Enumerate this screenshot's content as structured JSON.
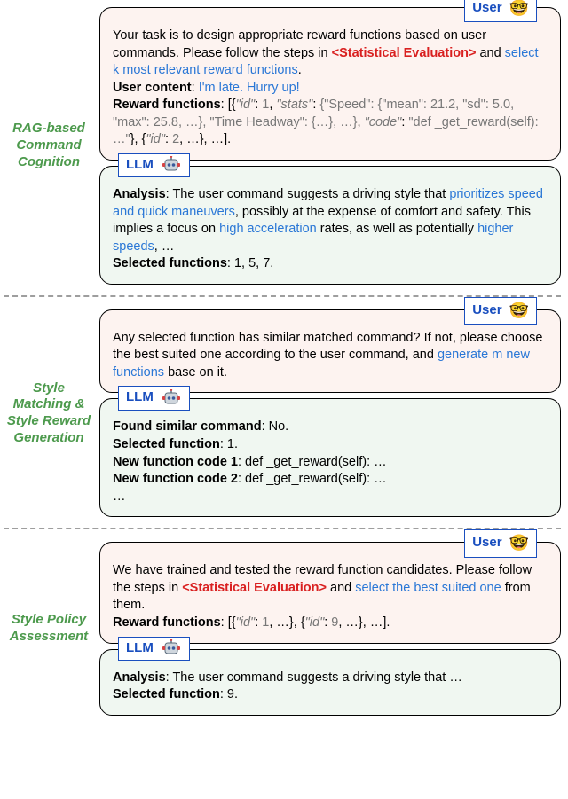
{
  "labels": {
    "section1": "RAG-based Command Cognition",
    "section2": "Style Matching & Style Reward Generation",
    "section3": "Style Policy Assessment"
  },
  "tags": {
    "user": "User",
    "llm": "LLM"
  },
  "s1": {
    "user": {
      "p1a": "Your task is to design appropriate reward functions based on user commands. Please follow the steps in ",
      "p1_red": "<Statistical Evaluation>",
      "p1b": " and ",
      "p1_blue": "select k most relevant reward functions",
      "p1c": ".",
      "p2_lead": "User content",
      "p2_sep": ": ",
      "p2_blue": "I'm late. Hurry up!",
      "p3_lead": "Reward functions",
      "p3a": ": [{",
      "p3_id1": "\"id\"",
      "p3b": ": ",
      "p3_v1": "1",
      "p3c": ", ",
      "p3_stats": "\"stats\"",
      "p3d": ": ",
      "p3_gray": "{\"Speed\": {\"mean\": 21.2, \"sd\": 5.0, \"max\": 25.8, …}, \"Time Headway\": {…}, …}",
      "p3e": ", ",
      "p3_code": "\"code\"",
      "p3f": ": ",
      "p3_codeval": "\"def _get_reward(self): …\"",
      "p3g": "}, {",
      "p3_id2": "\"id\"",
      "p3h": ": ",
      "p3_v2": "2",
      "p3i": ", …}, …]."
    },
    "llm": {
      "lead": "Analysis",
      "a1": ": The user command suggests a driving style that ",
      "blue1": "prioritizes speed and quick maneuvers",
      "a2": ", possibly at the expense of comfort and safety. This implies a focus on ",
      "blue2": "high acceleration",
      "a3": " rates, as well as potentially ",
      "blue3": "higher speeds",
      "a4": ", …",
      "sel_lead": "Selected functions",
      "sel": ": 1, 5, 7."
    }
  },
  "s2": {
    "user": {
      "p1a": "Any selected function has similar matched command? If not, please choose the best suited one according to the user command, and ",
      "p1_blue": "generate m new functions",
      "p1b": " base on it."
    },
    "llm": {
      "l1_lead": "Found similar command",
      "l1": ": No.",
      "l2_lead": "Selected function",
      "l2": ": 1.",
      "l3_lead": "New function code 1",
      "l3": ": def _get_reward(self): …",
      "l4_lead": "New function code 2",
      "l4": ": def _get_reward(self): …",
      "l5": "…"
    }
  },
  "s3": {
    "user": {
      "p1a": "We have trained and tested the reward function candidates. Please follow the steps in ",
      "p1_red": "<Statistical Evaluation>",
      "p1b": " and ",
      "p1_blue": "select the best suited one",
      "p1c": " from them.",
      "p2_lead": "Reward functions",
      "p2a": ": [{",
      "p2_id1": "\"id\"",
      "p2b": ": ",
      "p2_v1": "1",
      "p2c": ", …}, {",
      "p2_id2": "\"id\"",
      "p2d": ": ",
      "p2_v2": "9",
      "p2e": ", …}, …]."
    },
    "llm": {
      "lead": "Analysis",
      "a1": ": The user command suggests a driving style that …",
      "sel_lead": "Selected function",
      "sel": ": 9."
    }
  }
}
